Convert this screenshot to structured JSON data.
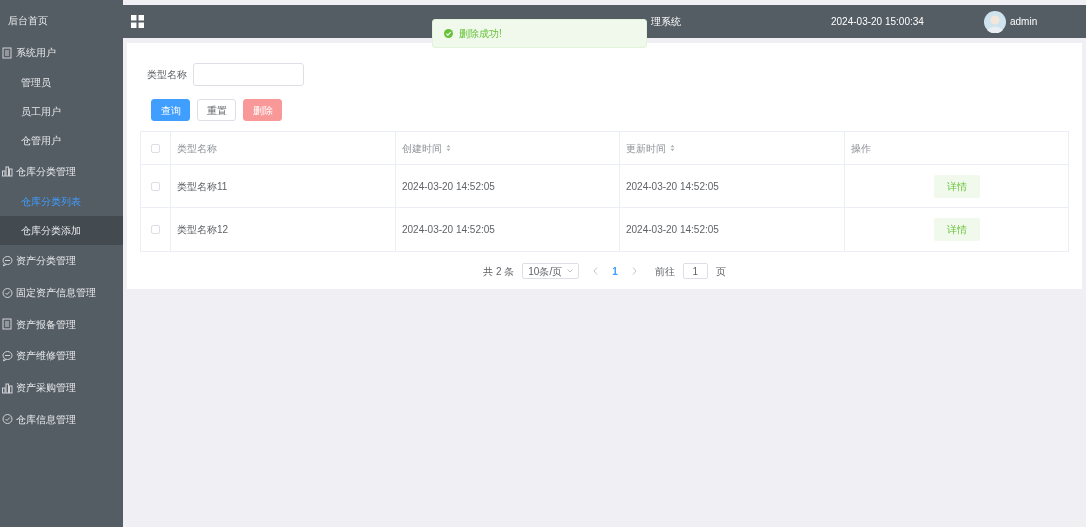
{
  "sidebar": {
    "items": [
      {
        "label": "后台首页",
        "kind": "plain"
      },
      {
        "label": "系统用户",
        "kind": "doc",
        "children": [
          {
            "label": "管理员",
            "selected": false,
            "hovered": false
          },
          {
            "label": "员工用户",
            "selected": false,
            "hovered": false
          },
          {
            "label": "仓管用户",
            "selected": false,
            "hovered": false
          }
        ]
      },
      {
        "label": "仓库分类管理",
        "kind": "chart",
        "children": [
          {
            "label": "仓库分类列表",
            "selected": true,
            "hovered": false
          },
          {
            "label": "仓库分类添加",
            "selected": false,
            "hovered": true
          }
        ]
      },
      {
        "label": "资产分类管理",
        "kind": "chat"
      },
      {
        "label": "固定资产信息管理",
        "kind": "check"
      },
      {
        "label": "资产报备管理",
        "kind": "doc"
      },
      {
        "label": "资产维修管理",
        "kind": "chat"
      },
      {
        "label": "资产采购管理",
        "kind": "chart"
      },
      {
        "label": "仓库信息管理",
        "kind": "check"
      }
    ]
  },
  "header": {
    "title": "理系统",
    "datetime": "2024-03-20 15:00:34",
    "user": "admin"
  },
  "toast": {
    "message": "删除成功!"
  },
  "search": {
    "label": "类型名称"
  },
  "buttons": [
    {
      "label": "查询",
      "kind": "primary"
    },
    {
      "label": "重置",
      "kind": "default"
    },
    {
      "label": "删除",
      "kind": "danger"
    }
  ],
  "table": {
    "all_checked": false,
    "columns": [
      {
        "label": "类型名称",
        "sortable": false
      },
      {
        "label": "创建时间",
        "sortable": true
      },
      {
        "label": "更新时间",
        "sortable": true
      },
      {
        "label": "操作",
        "sortable": false
      }
    ],
    "rows": [
      {
        "checked": false,
        "cells": [
          "类型名称11",
          "2024-03-20 14:52:05",
          "2024-03-20 14:52:05"
        ],
        "action": "详情"
      },
      {
        "checked": false,
        "cells": [
          "类型名称12",
          "2024-03-20 14:52:05",
          "2024-03-20 14:52:05"
        ],
        "action": "详情"
      }
    ]
  },
  "pagination": {
    "total": "共 2 条",
    "page_size": "10条/页",
    "pages": [
      {
        "label": "1",
        "selected": true
      }
    ],
    "goto_label": "前往",
    "goto_value": "1",
    "goto_suffix": "页"
  }
}
